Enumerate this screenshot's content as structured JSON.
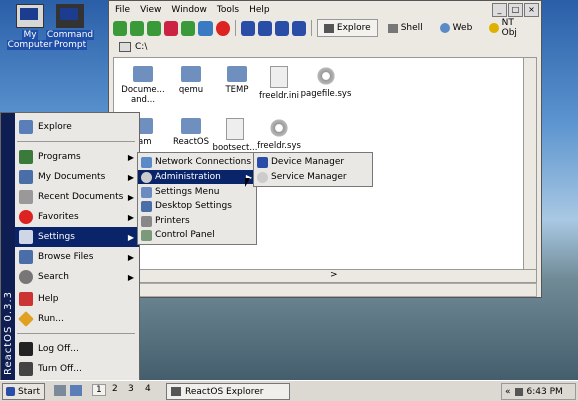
{
  "desktop": {
    "icons": [
      {
        "label1": "My",
        "label2": "Computer"
      },
      {
        "label1": "Command",
        "label2": "Prompt"
      }
    ]
  },
  "window": {
    "menus": [
      "File",
      "View",
      "Window",
      "Tools",
      "Help"
    ],
    "tabs": [
      "Explore",
      "Shell",
      "Web",
      "NT Obj"
    ],
    "address": "C:\\",
    "files": [
      {
        "name1": "Docume...",
        "name2": "and...",
        "type": "folder"
      },
      {
        "name1": "qemu",
        "name2": "",
        "type": "folder"
      },
      {
        "name1": "TEMP",
        "name2": "",
        "type": "folder"
      },
      {
        "name1": "freeldr.ini",
        "name2": "",
        "type": "doc"
      },
      {
        "name1": "pagefile.sys",
        "name2": "",
        "type": "gear"
      },
      {
        "name1": "ram",
        "name2": "",
        "type": "folder"
      },
      {
        "name1": "ReactOS",
        "name2": "",
        "type": "folder"
      },
      {
        "name1": "bootsect...",
        "name2": "",
        "type": "doc"
      },
      {
        "name1": "freeldr.sys",
        "name2": "",
        "type": "gear"
      }
    ],
    "scroll_arrow": ">"
  },
  "startmenu": {
    "brand": "ReactOS 0.3.3",
    "items": {
      "explore": "Explore",
      "programs": "Programs",
      "documents": "My Documents",
      "recent": "Recent Documents",
      "favorites": "Favorites",
      "settings": "Settings",
      "browse": "Browse Files",
      "search": "Search",
      "help": "Help",
      "run": "Run...",
      "logoff": "Log Off...",
      "turnoff": "Turn Off..."
    }
  },
  "settings_menu": {
    "items": [
      "Network Connections",
      "Administration",
      "Settings Menu",
      "Desktop Settings",
      "Printers",
      "Control Panel"
    ]
  },
  "admin_menu": {
    "items": [
      "Device Manager",
      "Service Manager"
    ]
  },
  "taskbar": {
    "start": "Start",
    "workspaces": [
      "1",
      "2",
      "3",
      "4"
    ],
    "task": "ReactOS Explorer",
    "tray_arrow": "«",
    "time": "6:43 PM"
  }
}
